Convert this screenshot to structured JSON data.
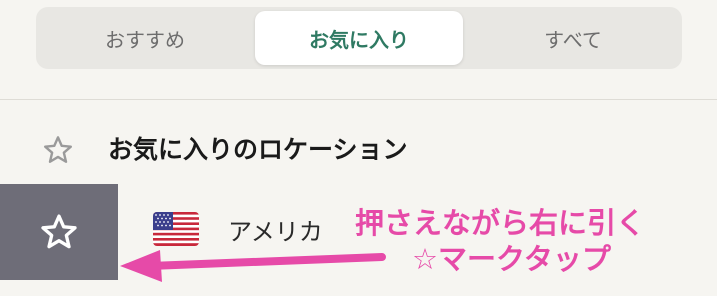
{
  "tabs": [
    {
      "label": "おすすめ",
      "selected": false
    },
    {
      "label": "お気に入り",
      "selected": true
    },
    {
      "label": "すべて",
      "selected": false
    }
  ],
  "section": {
    "title": "お気に入りのロケーション",
    "icon": "star-outline-icon"
  },
  "favorite_row": {
    "action_icon": "star-outline-icon",
    "flag_icon": "us-flag-icon",
    "label": "アメリカ"
  },
  "annotation": {
    "line1": "押さえながら右に引く",
    "line2": "☆マークタップ",
    "color": "#e64aa8"
  },
  "colors": {
    "accent": "#2f7a63",
    "action_bg": "#6e6d78",
    "background": "#f6f5f1"
  }
}
